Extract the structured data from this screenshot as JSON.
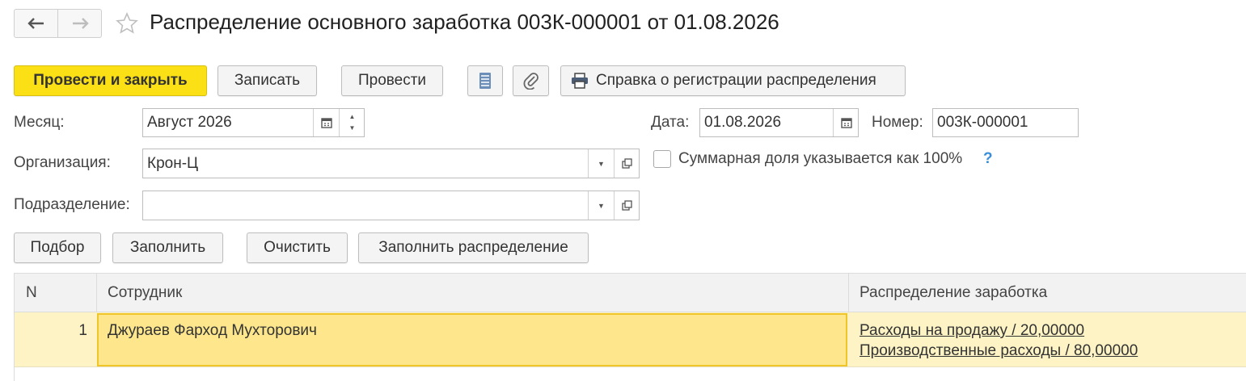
{
  "nav": {
    "back_icon": "arrow-left-icon",
    "forward_icon": "arrow-right-icon",
    "favorite_icon": "star-icon"
  },
  "title": "Распределение основного заработка 003К-000001 от 01.08.2026",
  "toolbar": {
    "post_close": "Провести и закрыть",
    "save": "Записать",
    "post": "Провести",
    "report_icon": "report-list-icon",
    "attach_icon": "paperclip-icon",
    "print_icon": "printer-icon",
    "certificate": "Справка о регистрации распределения"
  },
  "form": {
    "month_label": "Месяц:",
    "month_value": "Август 2026",
    "date_label": "Дата:",
    "date_value": "01.08.2026",
    "number_label": "Номер:",
    "number_value": "003К-000001",
    "org_label": "Организация:",
    "org_value": "Крон-Ц",
    "dept_label": "Подразделение:",
    "dept_value": "",
    "total_share_label": "Суммарная доля указывается как 100%",
    "total_share_checked": false,
    "help": "?"
  },
  "table_toolbar": {
    "pick": "Подбор",
    "fill": "Заполнить",
    "clear": "Очистить",
    "fill_distribution": "Заполнить распределение"
  },
  "table": {
    "columns": [
      "N",
      "Сотрудник",
      "Распределение заработка"
    ],
    "rows": [
      {
        "n": "1",
        "employee": "Джураев Фарход Мухторович",
        "distribution": [
          "Расходы на продажу / 20,00000",
          "Производственные расходы / 80,00000"
        ]
      }
    ]
  },
  "colors": {
    "primary": "#fbe016",
    "selected_row": "#fdf3c4",
    "selected_cell": "#fde68c",
    "help": "#3a8fd8"
  }
}
